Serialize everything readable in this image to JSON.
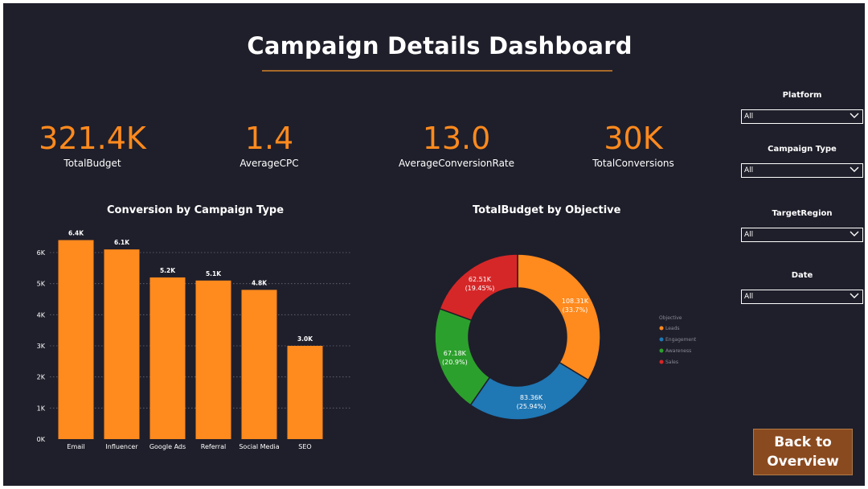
{
  "dashboard": {
    "title": "Campaign Details Dashboard"
  },
  "kpis": [
    {
      "value": "321.4K",
      "label": "TotalBudget"
    },
    {
      "value": "1.4",
      "label": "AverageCPC"
    },
    {
      "value": "13.0",
      "label": "AverageConversionRate"
    },
    {
      "value": "30K",
      "label": "TotalConversions"
    }
  ],
  "filters": [
    {
      "label": "Platform",
      "value": "All"
    },
    {
      "label": "Campaign Type",
      "value": "All"
    },
    {
      "label": "TargetRegion",
      "value": "All"
    },
    {
      "label": "Date",
      "value": "All"
    }
  ],
  "button": {
    "label": "Back to\nOverview"
  },
  "colors": {
    "accent": "#ff8a1d",
    "background": "#1f1f2b",
    "button": "#8a4a1f"
  },
  "chart_data": [
    {
      "type": "bar",
      "title": "Conversion by Campaign Type",
      "categories": [
        "Email",
        "Influencer",
        "Google Ads",
        "Referral",
        "Social Media",
        "SEO"
      ],
      "values": [
        6400,
        6100,
        5200,
        5100,
        4800,
        3000
      ],
      "data_labels": [
        "6.4K",
        "6.1K",
        "5.2K",
        "5.1K",
        "4.8K",
        "3.0K"
      ],
      "y_ticks": [
        "0K",
        "1K",
        "2K",
        "3K",
        "4K",
        "5K",
        "6K"
      ],
      "ylim": [
        0,
        6000
      ],
      "grid": true,
      "color": "#ff8a1d"
    },
    {
      "type": "pie",
      "title": "TotalBudget by Objective",
      "legend_title": "Objective",
      "legend_position": "right",
      "slices": [
        {
          "name": "Leads",
          "value": 108310,
          "label": "108.31K",
          "percent_label": "(33.7%)",
          "color": "#ff8a1d"
        },
        {
          "name": "Engagement",
          "value": 83360,
          "label": "83.36K",
          "percent_label": "(25.94%)",
          "color": "#1f77b4"
        },
        {
          "name": "Awareness",
          "value": 67180,
          "label": "67.18K",
          "percent_label": "(20.9%)",
          "color": "#2ca02c"
        },
        {
          "name": "Sales",
          "value": 62510,
          "label": "62.51K",
          "percent_label": "(19.45%)",
          "color": "#d62728"
        }
      ]
    }
  ]
}
